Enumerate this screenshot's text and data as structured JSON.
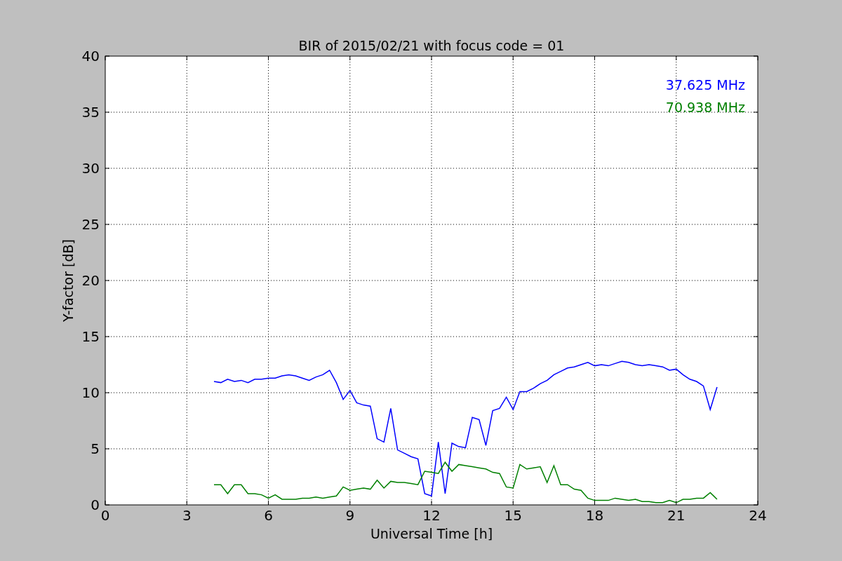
{
  "figure": {
    "chart_data": {
      "type": "line",
      "title": "BIR of 2015/02/21 with focus code = 01",
      "xlabel": "Universal Time [h]",
      "ylabel": "Y-factor [dB]",
      "x": [
        4,
        4.25,
        4.5,
        4.75,
        5,
        5.25,
        5.5,
        5.75,
        6,
        6.25,
        6.5,
        6.75,
        7,
        7.25,
        7.5,
        7.75,
        8,
        8.25,
        8.5,
        8.75,
        9,
        9.25,
        9.5,
        9.75,
        10,
        10.25,
        10.5,
        10.75,
        11,
        11.25,
        11.5,
        11.75,
        12,
        12.25,
        12.5,
        12.75,
        13,
        13.25,
        13.5,
        13.75,
        14,
        14.25,
        14.5,
        14.75,
        15,
        15.25,
        15.5,
        15.75,
        16,
        16.25,
        16.5,
        16.75,
        17,
        17.25,
        17.5,
        17.75,
        18,
        18.25,
        18.5,
        18.75,
        19,
        19.25,
        19.5,
        19.75,
        20,
        20.25,
        20.5,
        20.75,
        21,
        21.25,
        21.5,
        21.75,
        22,
        22.25,
        22.5
      ],
      "series": [
        {
          "name": "37.625 MHz",
          "color": "#0000ff",
          "values": [
            11,
            10.9,
            11.2,
            11,
            11.1,
            10.9,
            11.2,
            11.2,
            11.3,
            11.3,
            11.5,
            11.6,
            11.5,
            11.3,
            11.1,
            11.4,
            11.6,
            12,
            10.9,
            9.4,
            10.2,
            9.1,
            8.9,
            8.8,
            5.9,
            5.6,
            8.6,
            4.9,
            4.6,
            4.3,
            4.1,
            1.0,
            0.8,
            5.6,
            1.0,
            5.5,
            5.2,
            5.1,
            7.8,
            7.6,
            5.3,
            8.4,
            8.6,
            9.6,
            8.5,
            10.1,
            10.1,
            10.4,
            10.8,
            11.1,
            11.6,
            11.9,
            12.2,
            12.3,
            12.5,
            12.7,
            12.4,
            12.5,
            12.4,
            12.6,
            12.8,
            12.7,
            12.5,
            12.4,
            12.5,
            12.4,
            12.3,
            12,
            12.1,
            11.6,
            11.2,
            11,
            10.6,
            8.5,
            10.5
          ]
        },
        {
          "name": "70.938 MHz",
          "color": "#008000",
          "values": [
            1.8,
            1.8,
            1.0,
            1.8,
            1.8,
            1.0,
            1.0,
            0.9,
            0.6,
            0.9,
            0.5,
            0.5,
            0.5,
            0.6,
            0.6,
            0.7,
            0.6,
            0.7,
            0.8,
            1.6,
            1.3,
            1.4,
            1.5,
            1.4,
            2.2,
            1.5,
            2.1,
            2.0,
            2.0,
            1.9,
            1.8,
            3.0,
            2.9,
            2.8,
            3.8,
            3.0,
            3.6,
            3.5,
            3.4,
            3.3,
            3.2,
            2.9,
            2.8,
            1.6,
            1.5,
            3.6,
            3.2,
            3.3,
            3.4,
            2.0,
            3.5,
            1.8,
            1.8,
            1.4,
            1.3,
            0.6,
            0.4,
            0.4,
            0.4,
            0.6,
            0.5,
            0.4,
            0.5,
            0.3,
            0.3,
            0.2,
            0.2,
            0.4,
            0.2,
            0.5,
            0.5,
            0.6,
            0.6,
            1.1,
            0.5
          ]
        }
      ],
      "grid": true,
      "xlim": [
        0,
        24
      ],
      "ylim": [
        0,
        40
      ],
      "xticks": [
        0,
        3,
        6,
        9,
        12,
        15,
        18,
        21,
        24
      ],
      "yticks": [
        0,
        5,
        10,
        15,
        20,
        25,
        30,
        35,
        40
      ]
    }
  }
}
